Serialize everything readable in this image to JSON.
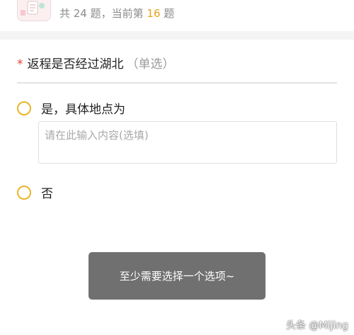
{
  "header": {
    "progress_prefix": "共 24 题，当前第 ",
    "progress_current": "16",
    "progress_suffix": " 题"
  },
  "question": {
    "required_mark": "*",
    "title": "返程是否经过湖北",
    "type_label": "（单选）",
    "options": [
      {
        "label": "是，具体地点为"
      },
      {
        "label": "否"
      }
    ],
    "other_input": {
      "value": "",
      "placeholder": "请在此输入内容(选填)"
    }
  },
  "toast": {
    "text": "至少需要选择一个选项~"
  },
  "watermark": {
    "text": "头条 @Mijing"
  },
  "colors": {
    "accent_yellow": "#e8b62a",
    "current_number": "#e8a21c",
    "required_red": "#e0472a",
    "toast_bg": "#707070"
  },
  "icons": {
    "radio": "radio-circle-icon",
    "thumbnail": "survey-illustration-icon"
  }
}
